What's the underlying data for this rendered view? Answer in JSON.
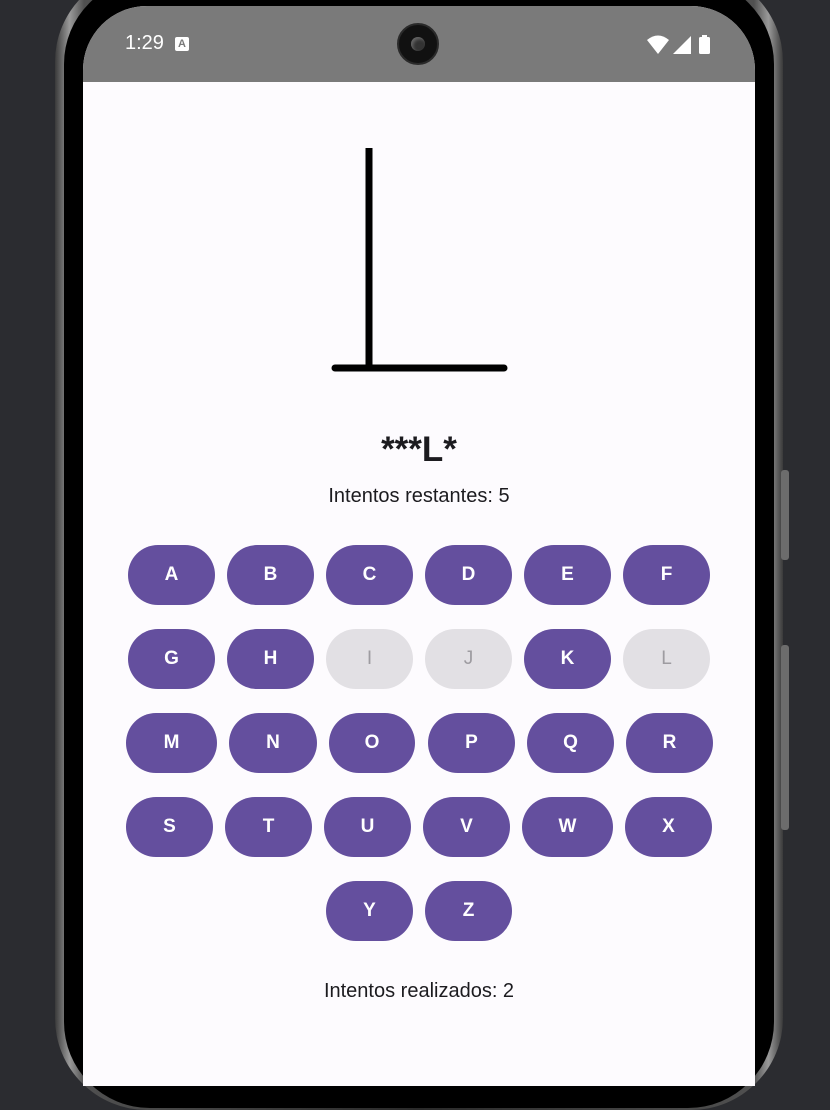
{
  "status_bar": {
    "time": "1:29",
    "notification_icon": "a-icon",
    "icons": [
      "wifi-icon",
      "signal-icon",
      "battery-icon"
    ]
  },
  "game": {
    "masked_word": "***L*",
    "remaining_attempts": "Intentos restantes: 5",
    "attempts_made": "Intentos realizados: 2"
  },
  "keyboard": {
    "rows": [
      [
        "A",
        "B",
        "C",
        "D",
        "E",
        "F"
      ],
      [
        "G",
        "H",
        "I",
        "J",
        "K",
        "L"
      ],
      [
        "M",
        "N",
        "O",
        "P",
        "Q",
        "R"
      ],
      [
        "S",
        "T",
        "U",
        "V",
        "W",
        "X"
      ],
      [
        "Y",
        "Z"
      ]
    ],
    "disabled": [
      "I",
      "J",
      "L"
    ]
  },
  "colors": {
    "key_active": "#644f9e",
    "key_disabled": "#e2e0e4",
    "background": "#fdfbfe",
    "status_bar": "#7a7a7a"
  }
}
